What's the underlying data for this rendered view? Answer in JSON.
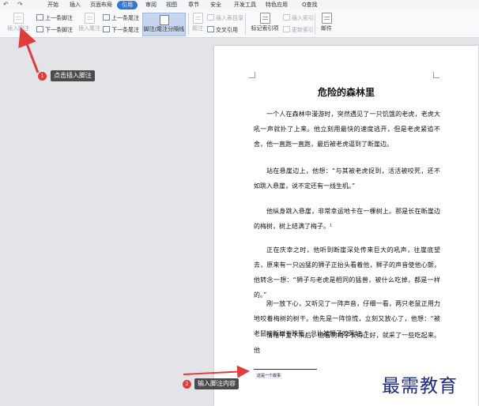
{
  "menubar": {
    "undo_glyph": "↶",
    "redo_glyph": "↷",
    "items": [
      "开始",
      "插入",
      "页面布局",
      "引用",
      "审阅",
      "视图",
      "章节",
      "安全",
      "开发工具",
      "特色应用"
    ],
    "active_index": 3,
    "search_label": "Q查找"
  },
  "ribbon": {
    "insert_footnote": "插入脚注",
    "prev_footnote": "上一条脚注",
    "next_footnote": "下一条脚注",
    "insert_endnote": "插入尾注",
    "prev_endnote": "上一条尾注",
    "next_endnote": "下一条尾注",
    "separator": "脚注/尾注分隔线",
    "caption": "题注",
    "insert_toc": "插入表目录",
    "cross_ref": "交叉引用",
    "mark_index": "标记索引项",
    "insert_index": "插入索引",
    "update_index": "更新索引",
    "mail": "邮件"
  },
  "document": {
    "title": "危险的森林里",
    "paragraphs": [
      "一个人在森林中漫游时，突然遇见了一只饥饿的老虎，老虎大吼一声就扑了上来。他立刻用最快的速度逃开，但是老虎紧追不舍，他一直跑一直跑，最后被老虎逼到了断崖边。",
      "站在悬崖边上，他想：“与其被老虎捉到，活活被咬死，还不如跳入悬崖，说不定还有一线生机。”",
      "他纵身跳入悬崖，非常幸运地卡在一棵树上。那是长在断崖边的梅树，树上结满了梅子。¹",
      "正在庆幸之时，他听到断崖深处传来巨大的吼声，往崖底望去，原来有一只凶猛的狮子正抬头看着他，狮子的声音使他心颤，他转念一想：“狮子与老虎是相同的猛兽，被什么吃掉，都是一样的。”",
      "刚一放下心，又听见了一阵声音，仔细一看，两只老鼠正用力地咬着梅树的树干。他先是一阵惊慌，立刻又放心了，他想：“被老鼠咬断树干跌死，总比被狮子咬死好。”",
      "情绪平复下来后，他看到梅子长得正好，就采了一些吃起来。他"
    ],
    "footnote_text": "这是一个故事"
  },
  "callouts": [
    {
      "number": "1",
      "label": "点击插入脚注"
    },
    {
      "number": "2",
      "label": "输入脚注内容"
    }
  ],
  "watermark": "最需教育",
  "colors": {
    "accent": "#2f78d8",
    "badge": "#e23b3b",
    "callout_bg": "#4b4b4b",
    "watermark": "#1b2a88"
  }
}
